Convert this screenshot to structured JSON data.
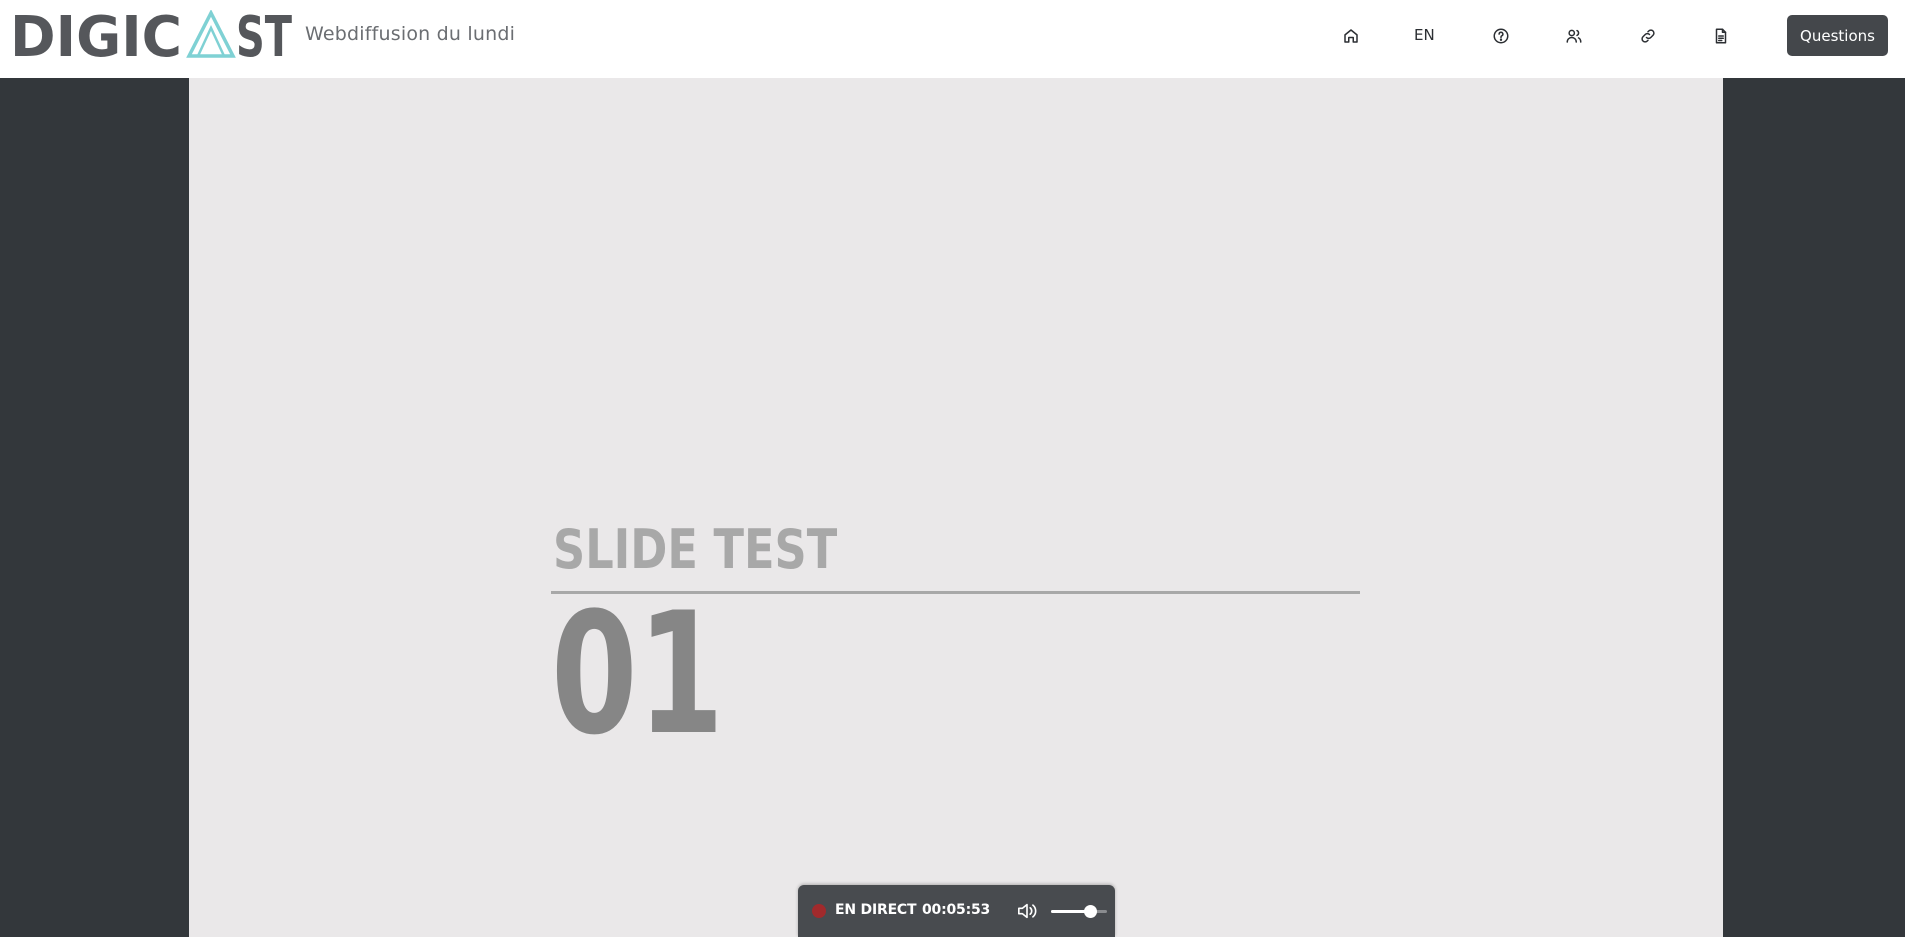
{
  "brand": {
    "logo_text": "DIGICAST",
    "accent_color": "#7fd1d4",
    "dark_color": "#55575b"
  },
  "header": {
    "event_title": "Webdiffusion du lundi",
    "language": "EN",
    "questions_label": "Questions",
    "icons": [
      "home-icon",
      "help-icon",
      "users-icon",
      "link-icon",
      "document-icon"
    ]
  },
  "slide": {
    "title": "SLIDE TEST",
    "number": "01"
  },
  "player": {
    "live_label": "EN DIRECT",
    "elapsed": "00:05:53",
    "volume": 0.72,
    "live_color": "#a12a2c"
  }
}
